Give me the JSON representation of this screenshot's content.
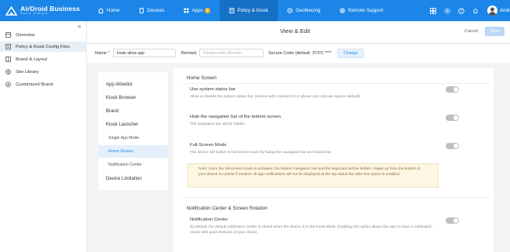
{
  "topbar": {
    "brand_name": "AirDroid Business",
    "brand_sub": "Sand Simple",
    "nav": [
      {
        "label": "Home",
        "icon": "home-icon"
      },
      {
        "label": "Devices",
        "icon": "devices-icon"
      },
      {
        "label": "Apps",
        "icon": "apps-icon",
        "badge": "5"
      },
      {
        "label": "Policy & Kiosk",
        "icon": "policy-icon"
      },
      {
        "label": "Geofencing",
        "icon": "geofence-icon"
      },
      {
        "label": "Remote Support",
        "icon": "remote-support-icon"
      }
    ],
    "user_name": "Airdroi",
    "accent": "#1b86e8"
  },
  "sidebar": {
    "items": [
      {
        "label": "Overview"
      },
      {
        "label": "Policy & Kiosk Config Files"
      },
      {
        "label": "Brand & Layout"
      },
      {
        "label": "Site Library"
      },
      {
        "label": "Customized Brand"
      }
    ]
  },
  "header": {
    "title": "View & Edit",
    "cancel": "Cancel",
    "save": "Save"
  },
  "form": {
    "name_label": "Name",
    "name_required": "*",
    "name_value": "kiosk allow app",
    "remark_label": "Remark",
    "remark_placeholder": "Please enter Remark",
    "secure_code": "Secure Code (default: 3737) ****",
    "change": "Change"
  },
  "left_menu": {
    "items": [
      {
        "label": "App Allowlist"
      },
      {
        "label": "Kiosk Browser"
      },
      {
        "label": "Brand"
      },
      {
        "label": "Kiosk Launcher"
      },
      {
        "label": "Single App Mode"
      },
      {
        "label": "Home Screen"
      },
      {
        "label": "Notification Center"
      },
      {
        "label": "Device Limitation"
      }
    ]
  },
  "panel": {
    "section1": "Home Screen",
    "s1_title": "Use system status bar",
    "s1_desc": "Allow or disable the system status bar. (Device with Android 8.0 or above can only use system default)",
    "s2_title": "Hide the navigation bar of the bottom screen",
    "s2_desc": "The navigation bar will be hidden.",
    "s3_title": "Full-Screen Mode",
    "s3_desc": "The device will switch to full-screen mode by hiding the navigation bar and status bar.",
    "note": "Note: Once the full-screen mode is activated, the bottom navigation bar and the keyboard will be hidden. Swipe up from the bottom of your device to unhide if needed. All app notifications will not be displayed at the top status bar after this option is enabled.",
    "section2": "Notification Center & Screen Rotation",
    "s4_title": "Notification Center",
    "s4_desc": "By default, the default notification center is closed when the device is in the Kiosk Mode. Enabling this option allows the user to have a notification center with quick features of your choice."
  }
}
